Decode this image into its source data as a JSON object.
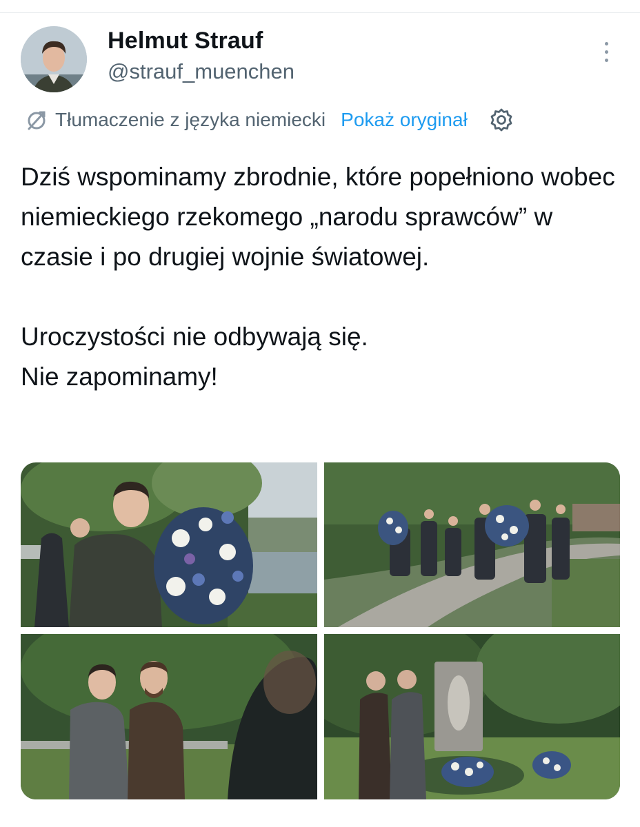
{
  "author": {
    "display_name": "Helmut Strauf",
    "handle": "@strauf_muenchen",
    "avatar_icon": "user-photo"
  },
  "translation": {
    "label": "Tłumaczenie z języka niemiecki",
    "show_original": "Pokaż oryginał",
    "link_color": "#1d9bf0"
  },
  "tweet": {
    "paragraph_1": "Dziś wspominamy zbrodnie, które popełniono wobec niemieckiego rzekomego „narodu sprawców” w czasie i po drugiej wojnie światowej.",
    "paragraph_2_line_1": "Uroczystości nie odbywają się.",
    "paragraph_2_line_2": "Nie zapominamy!"
  },
  "icons": {
    "more": "more-vertical-icon",
    "translate": "translate-icon",
    "settings": "gear-icon"
  }
}
